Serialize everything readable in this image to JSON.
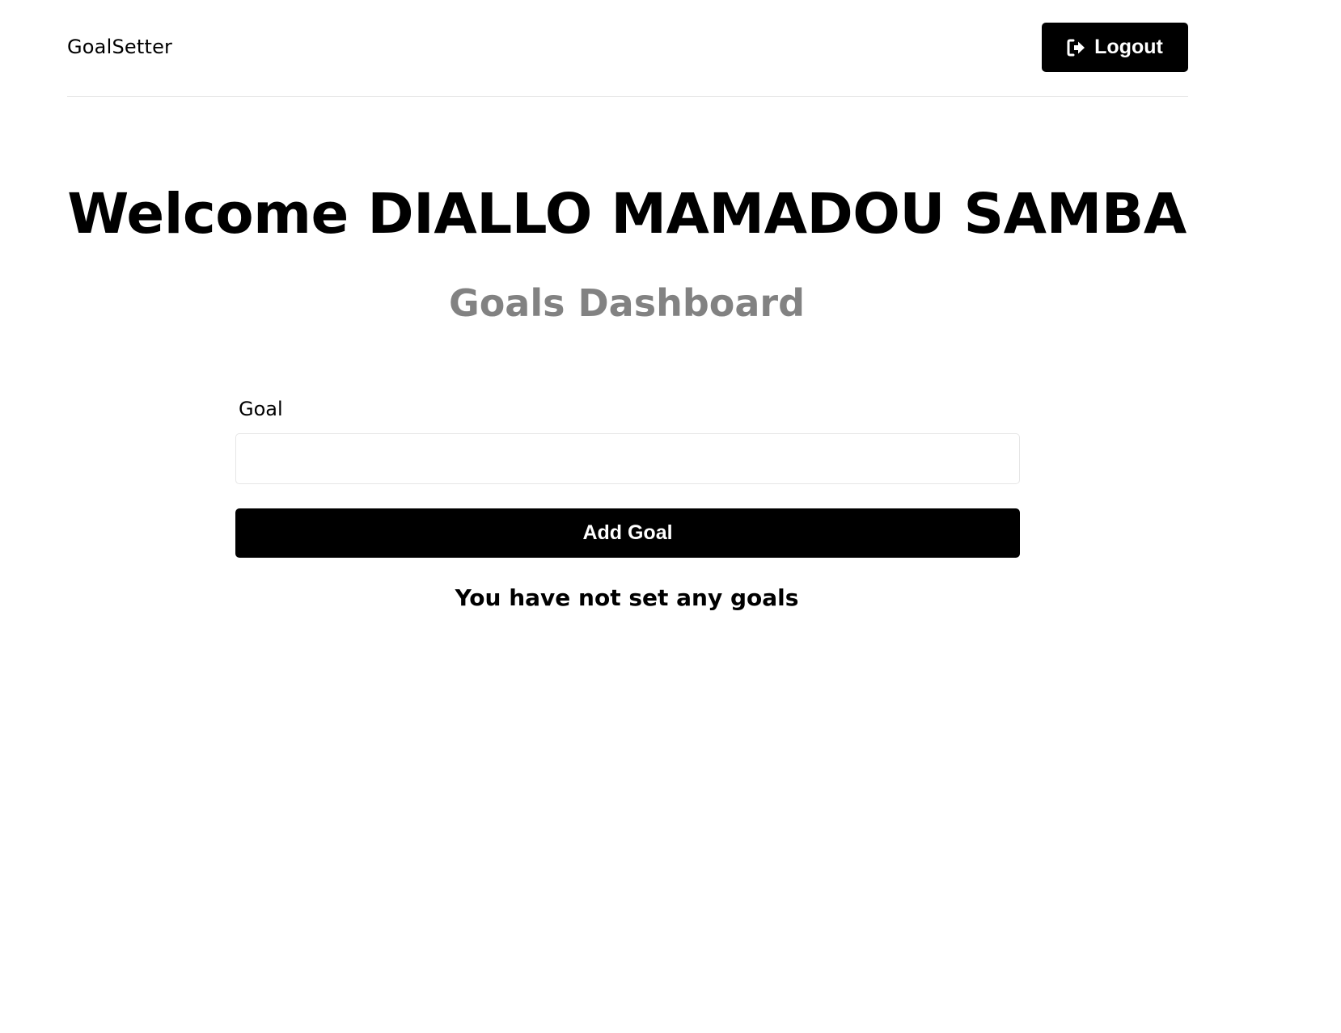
{
  "header": {
    "brand": "GoalSetter",
    "logout_label": "Logout",
    "logout_icon": "sign-out-icon"
  },
  "main": {
    "welcome": "Welcome DIALLO MAMADOU SAMBA",
    "subtitle": "Goals Dashboard"
  },
  "goal_form": {
    "label": "Goal",
    "value": "",
    "placeholder": "",
    "submit_label": "Add Goal"
  },
  "goals": {
    "empty_message": "You have not set any goals",
    "items": []
  },
  "colors": {
    "primary": "#000000",
    "subtitle": "#828282",
    "border": "#e6e6e6",
    "background": "#ffffff"
  }
}
